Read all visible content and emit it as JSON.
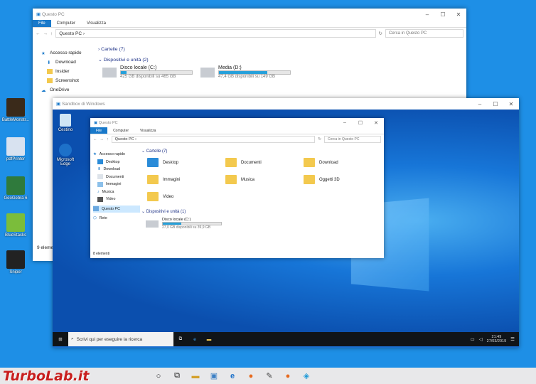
{
  "desktop_icons": [
    {
      "label": "BattleMonstr...",
      "color": "#3a2a1a"
    },
    {
      "label": "pdfPrinter",
      "color": "#d8e2f0"
    },
    {
      "label": "GeoGebra 6",
      "color": "#2f7a3c"
    },
    {
      "label": "BlueStacks",
      "color": "#7bbd3b"
    },
    {
      "label": "Sniper",
      "color": "#222"
    }
  ],
  "outer": {
    "title": "Questo PC",
    "ribbon": [
      "File",
      "Computer",
      "Visualizza"
    ],
    "path": "Questo PC",
    "search": "Cerca in Questo PC",
    "nav": [
      {
        "label": "Accesso rapido",
        "icon": "star-icon"
      },
      {
        "label": "Download",
        "icon": "download-icon"
      },
      {
        "label": "Insider",
        "icon": "folder-icon"
      },
      {
        "label": "Screenshot",
        "icon": "folder-icon"
      },
      {
        "label": "OneDrive",
        "icon": "cloud-icon"
      }
    ],
    "sections": {
      "folders": "Cartelle (7)",
      "devices": "Dispositivi e unità (2)"
    },
    "drives": [
      {
        "name": "Disco locale (C:)",
        "free": "425 GB disponibili su 465 GB",
        "used": 0.08
      },
      {
        "name": "Media (D:)",
        "free": "47,4 GB disponibili su 149 GB",
        "used": 0.68
      }
    ],
    "status": "9 elementi"
  },
  "sandbox": {
    "title": "Sandbox di Windows",
    "recycle_label": "Cestino",
    "edge_label": "Microsoft Edge",
    "explorer": {
      "title": "Questo PC",
      "ribbon": [
        "File",
        "Computer",
        "Visualizza"
      ],
      "path": "Questo PC",
      "search": "Cerca in Questo PC",
      "nav": [
        "Accesso rapido",
        "Desktop",
        "Download",
        "Documenti",
        "Immagini",
        "Musica",
        "Video",
        "Questo PC",
        "Rete"
      ],
      "folders_header": "Cartelle (7)",
      "folders": [
        "Desktop",
        "Documenti",
        "Download",
        "Immagini",
        "Musica",
        "Oggetti 3D",
        "Video"
      ],
      "devices_header": "Dispositivi e unità (1)",
      "drive": {
        "name": "Disco locale (C:)",
        "free": "27,0 GB disponibili su 39,9 GB",
        "used": 0.32
      },
      "status": "8 elementi"
    },
    "taskbar": {
      "search": "Scrivi qui per eseguire la ricerca",
      "time": "21:49",
      "date": "27/03/2019"
    }
  },
  "watermark": "TurboLab.it"
}
